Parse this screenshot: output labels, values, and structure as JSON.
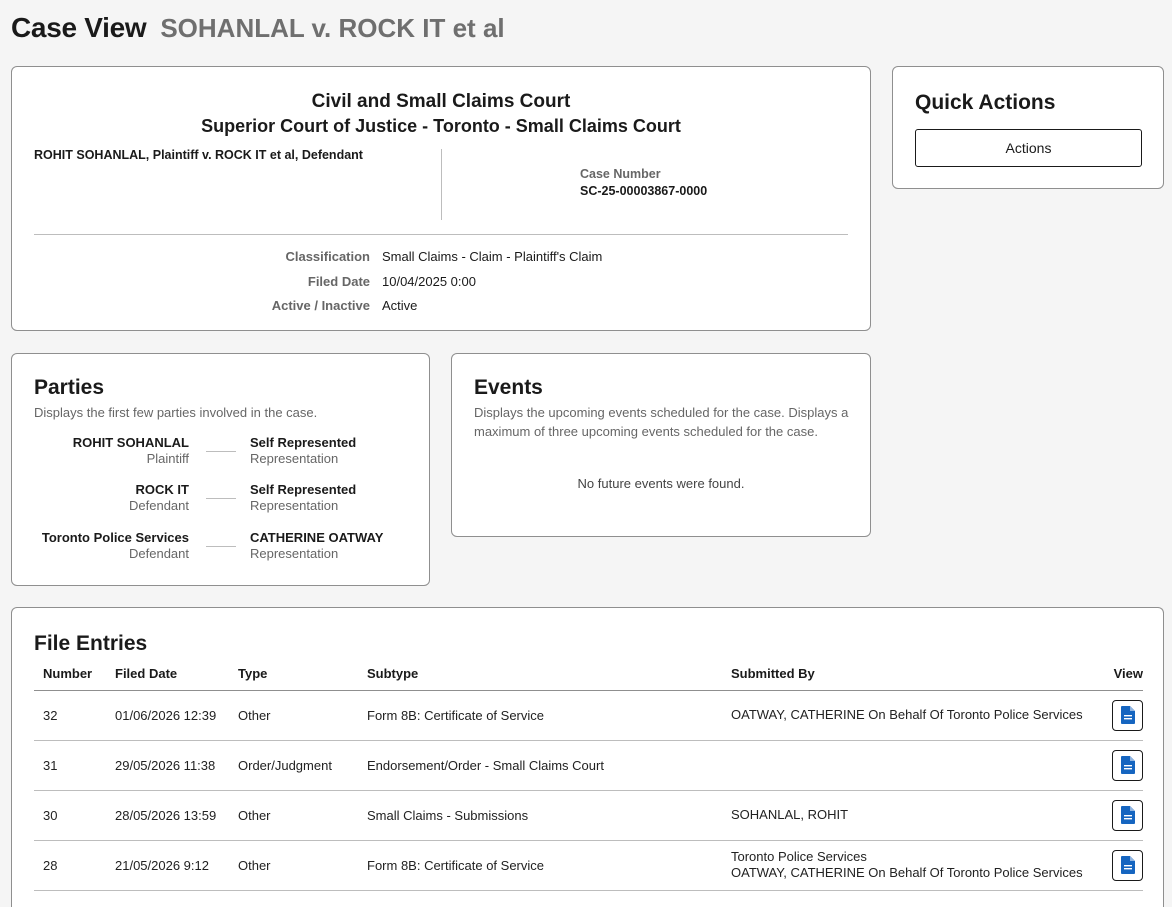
{
  "header": {
    "title": "Case View",
    "case_name": "SOHANLAL v. ROCK IT et al"
  },
  "summary": {
    "court_title": "Civil and Small Claims Court",
    "court_subtitle": "Superior Court of Justice - Toronto - Small Claims Court",
    "parties_line": "ROHIT SOHANLAL, Plaintiff v. ROCK IT et al, Defendant",
    "case_number_label": "Case Number",
    "case_number": "SC-25-00003867-0000",
    "details": [
      {
        "label": "Classification",
        "value": "Small Claims - Claim - Plaintiff's Claim"
      },
      {
        "label": "Filed Date",
        "value": "10/04/2025 0:00"
      },
      {
        "label": "Active / Inactive",
        "value": "Active"
      }
    ]
  },
  "quick_actions": {
    "title": "Quick Actions",
    "button_label": "Actions"
  },
  "parties": {
    "title": "Parties",
    "subtitle": "Displays the first few parties involved in the case.",
    "rows": [
      {
        "name": "ROHIT SOHANLAL",
        "role": "Plaintiff",
        "rep_name": "Self Represented",
        "rep_role": "Representation"
      },
      {
        "name": "ROCK IT",
        "role": "Defendant",
        "rep_name": "Self Represented",
        "rep_role": "Representation"
      },
      {
        "name": "Toronto Police Services",
        "role": "Defendant",
        "rep_name": "CATHERINE OATWAY",
        "rep_role": "Representation"
      }
    ]
  },
  "events": {
    "title": "Events",
    "subtitle": "Displays the upcoming events scheduled for the case. Displays a maximum of three upcoming events scheduled for the case.",
    "empty_message": "No future events were found."
  },
  "file_entries": {
    "title": "File Entries",
    "columns": [
      "Number",
      "Filed Date",
      "Type",
      "Subtype",
      "Submitted By",
      "View"
    ],
    "rows": [
      {
        "number": "32",
        "filed_date": "01/06/2026 12:39",
        "type": "Other",
        "subtype": "Form 8B: Certificate of Service",
        "submitted_by": [
          "OATWAY, CATHERINE On Behalf Of Toronto Police Services"
        ]
      },
      {
        "number": "31",
        "filed_date": "29/05/2026 11:38",
        "type": "Order/Judgment",
        "subtype": "Endorsement/Order - Small Claims Court",
        "submitted_by": []
      },
      {
        "number": "30",
        "filed_date": "28/05/2026 13:59",
        "type": "Other",
        "subtype": "Small Claims - Submissions",
        "submitted_by": [
          "SOHANLAL, ROHIT"
        ]
      },
      {
        "number": "28",
        "filed_date": "21/05/2026 9:12",
        "type": "Other",
        "subtype": "Form 8B: Certificate of Service",
        "submitted_by": [
          "Toronto Police Services",
          "OATWAY, CATHERINE On Behalf Of Toronto Police Services"
        ]
      }
    ]
  },
  "colors": {
    "accent_blue": "#1565c0",
    "border": "#8f8f8f",
    "muted_text": "#666666"
  }
}
